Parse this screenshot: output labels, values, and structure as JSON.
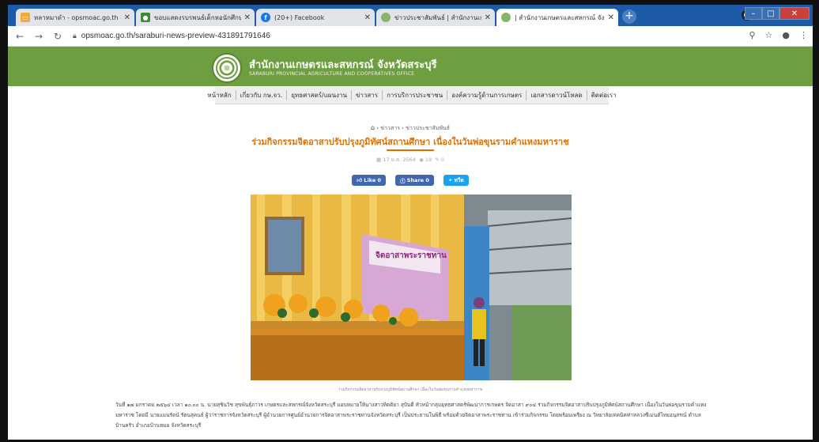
{
  "browser": {
    "tabs": [
      {
        "label": "หลาหมาดำ - opsmoac.go.th - Sm",
        "favicon_color": "#f0a93b"
      },
      {
        "label": "ขอบแสดงรบรพนธ์เด็กหอนักศึกษาจังหวัดสระ",
        "favicon_color": "#3a8a3a"
      },
      {
        "label": "(20+) Facebook",
        "favicon_color": "#1877f2"
      },
      {
        "label": "ข่าวประชาสัมพันธ์ | สำนักงานเกษตรและ",
        "favicon_color": "#8ab36a"
      },
      {
        "label": "| สำนักงานเกษตรและสหกรณ์ จังหวัดสระ",
        "favicon_color": "#8ab36a"
      }
    ],
    "url": "opsmoac.go.th/saraburi-news-preview-431891791646"
  },
  "site": {
    "org_name_th": "สำนักงานเกษตรและสหกรณ์ จังหวัดสระบุรี",
    "org_name_en": "SARABURI PROVINCIAL AGRICULTURE AND COOPERATIVES OFFICE",
    "brand_color": "#6d9e3f",
    "menu": [
      "หน้าหลัก",
      "เกี่ยวกับ กษ.จว.",
      "ยุทธศาสตร์/แผนงาน",
      "ข่าวสาร",
      "การบริการประชาชน",
      "องค์ความรู้ด้านการเกษตร",
      "เอกสารดาวน์โหลด",
      "ติดต่อเรา"
    ]
  },
  "article": {
    "breadcrumb": [
      "ข่าวสาร",
      "ข่าวประชาสัมพันธ์"
    ],
    "title": "ร่วมกิจกรรมจิตอาสาปรับปรุงภูมิทัศน์สถานศึกษา เนื่องในวันพ่อขุนรามคำแหงมหาราช",
    "date": "17 ม.ค. 2564",
    "views": "19",
    "comments": "0",
    "share": {
      "like": "Like 0",
      "fb_share": "Share 0",
      "tweet": "ทวีต"
    },
    "caption": "ร่วมกิจกรรมจิตอาสาปรับปรุงภูมิทัศน์สถานศึกษา เนื่องในวันพ่อขุนรามคำแหงมหาราช",
    "photo_banner": "จิตอาสาพระราชทาน",
    "body": "วันที่ ๑๗ มกราคม ๒๕๖๔ เวลา ๑๐.๐๐ น. นายสุชินวิช สุขพันธุ์ถาวร เกษตรและสหกรณ์จังหวัดสระบุรี มอบหมายให้นางสาวทิตติยา สุปันดี หัวหน้ากลุ่มยุทธศาสตร์พัฒนาการเกษตร จิตอาสา ๙๐๔ ร่วมกิจกรรมจิตอาสาปรับปรุงภูมิทัศน์สถานศึกษา เนื่องในวันพ่อขุนรามคำแหงมหาราช โดยมี นายแมนรัตน์ รัตนสุคนธ์ ผู้ว่าราชการจังหวัดสระบุรี ผู้อำนวยการศูนย์อำนวยการจิตอาสาพระราชทานจังหวัดสระบุรี เป็นประธานในพิธี พร้อมด้วยจิตอาสาพระราชทาน เข้าร่วมกิจกรรม โดยพร้อมเพรียง ณ วิทยาลัยเทคนิคท่าหลวงซีเมนต์ไทยอนุสรณ์ ตำบลบ้านครัว อำเภอบ้านหมอ จังหวัดสระบุรี"
  }
}
